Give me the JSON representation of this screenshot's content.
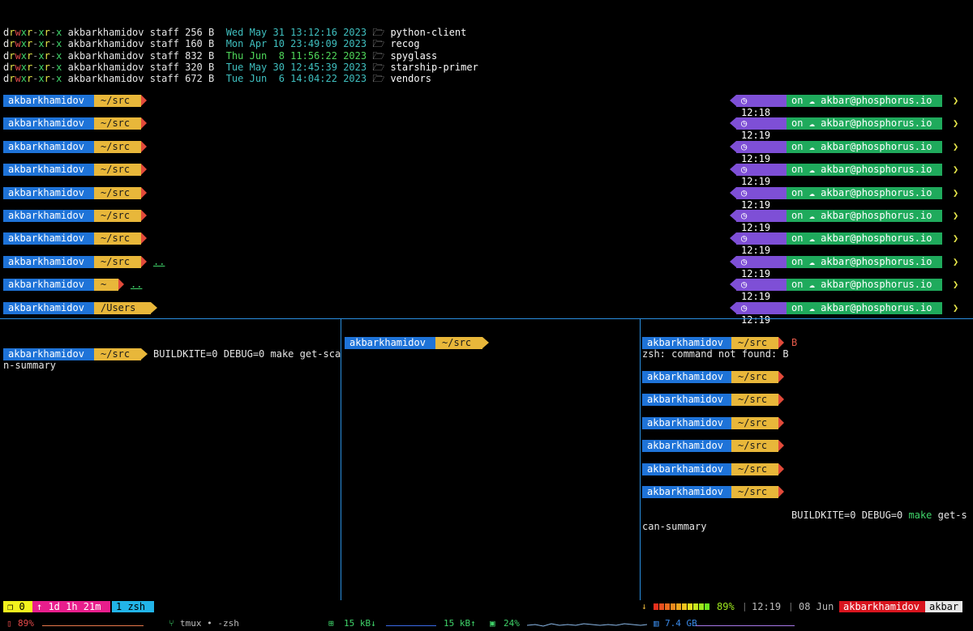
{
  "ls": [
    {
      "perm_d": "d",
      "perm": "rwxr-xr-x",
      "owner": "akbarkhamidov",
      "group": "staff",
      "size": "256",
      "unit": "B",
      "date": "Wed May 31 13:12:16 2023",
      "date_color": "blue",
      "icon": "🗁",
      "name": "python-client"
    },
    {
      "perm_d": "d",
      "perm": "rwxr-xr-x",
      "owner": "akbarkhamidov",
      "group": "staff",
      "size": "160",
      "unit": "B",
      "date": "Mon Apr 10 23:49:09 2023",
      "date_color": "blue",
      "icon": "🗁",
      "name": "recog"
    },
    {
      "perm_d": "d",
      "perm": "rwxr-xr-x",
      "owner": "akbarkhamidov",
      "group": "staff",
      "size": "832",
      "unit": "B",
      "date": "Thu Jun  8 11:56:22 2023",
      "date_color": "green",
      "icon": "🗁",
      "name": "spyglass"
    },
    {
      "perm_d": "d",
      "perm": "rwxr-xr-x",
      "owner": "akbarkhamidov",
      "group": "staff",
      "size": "320",
      "unit": "B",
      "date": "Tue May 30 12:45:39 2023",
      "date_color": "blue",
      "icon": "🗁",
      "name": "starship-primer"
    },
    {
      "perm_d": "d",
      "perm": "rwxr-xr-x",
      "owner": "akbarkhamidov",
      "group": "staff",
      "size": "672",
      "unit": "B",
      "date": "Tue Jun  6 14:04:22 2023",
      "date_color": "blue",
      "icon": "🗁",
      "name": "vendors"
    }
  ],
  "prompt_user": "akbarkhamidov",
  "top_prompts": [
    {
      "path": "~/src",
      "cmd": "",
      "time": "12:18"
    },
    {
      "path": "~/src",
      "cmd": "",
      "time": "12:19"
    },
    {
      "path": "~/src",
      "cmd": "",
      "time": "12:19"
    },
    {
      "path": "~/src",
      "cmd": "",
      "time": "12:19"
    },
    {
      "path": "~/src",
      "cmd": "",
      "time": "12:19"
    },
    {
      "path": "~/src",
      "cmd": "",
      "time": "12:19"
    },
    {
      "path": "~/src",
      "cmd": "",
      "time": "12:19"
    },
    {
      "path": "~/src",
      "cmd": "..",
      "time": "12:19"
    },
    {
      "path": "~",
      "cmd": "..",
      "time": "12:19"
    },
    {
      "path": "/Users",
      "cmd": "",
      "time": "12:19"
    }
  ],
  "right_on": "on",
  "right_cloud_icon": "cloud-icon",
  "right_account": "akbar@phosphorus.io",
  "right_chevron": "❯",
  "clock_icon": "clock-icon",
  "pane_left": {
    "path": "~/src",
    "cmd_line1": "BUILDKITE=0 DEBUG=0 make get-sca",
    "cmd_line2": "n-summary"
  },
  "pane_middle": {
    "path": "~/src"
  },
  "pane_right": {
    "first_cmd": "B",
    "error": "zsh: command not found: B",
    "paths": [
      "~/src",
      "~/src",
      "~/src",
      "~/src",
      "~/src",
      "~/src"
    ],
    "last_cmd_a": "BUILDKITE=0 DEBUG=0 ",
    "last_cmd_b": "make",
    "last_cmd_c": " get-s",
    "last_cmd_line2": "can-summary"
  },
  "status": {
    "session_icon": "❐",
    "session_num": "0",
    "uptime": "↑ 1d 1h 21m",
    "window": "1 zsh",
    "down_arrow": "↓",
    "battery": "89%",
    "sep": "|",
    "time": "12:19",
    "date": "08 Jun",
    "user": "akbarkhamidov",
    "host": "akbar",
    "meter_colors": [
      "#e8301e",
      "#e8501e",
      "#ec6a1e",
      "#ee8a1e",
      "#f0a81e",
      "#f2c41e",
      "#e8e01e",
      "#c8e81e",
      "#9ee81e",
      "#6ee81e"
    ]
  },
  "bottom": {
    "battery_pct": "89%",
    "app": "tmux • -zsh",
    "net_in": "15 kB↓",
    "net_out": "15 kB↑",
    "cpu": "24%",
    "mem": "7.4 GB"
  },
  "colors": {
    "user_bg": "#1e73d8",
    "path_bg": "#e8b73a",
    "time_bg": "#7e4fd6",
    "on_bg": "#1faa5c",
    "divider": "#2a8fe0"
  }
}
